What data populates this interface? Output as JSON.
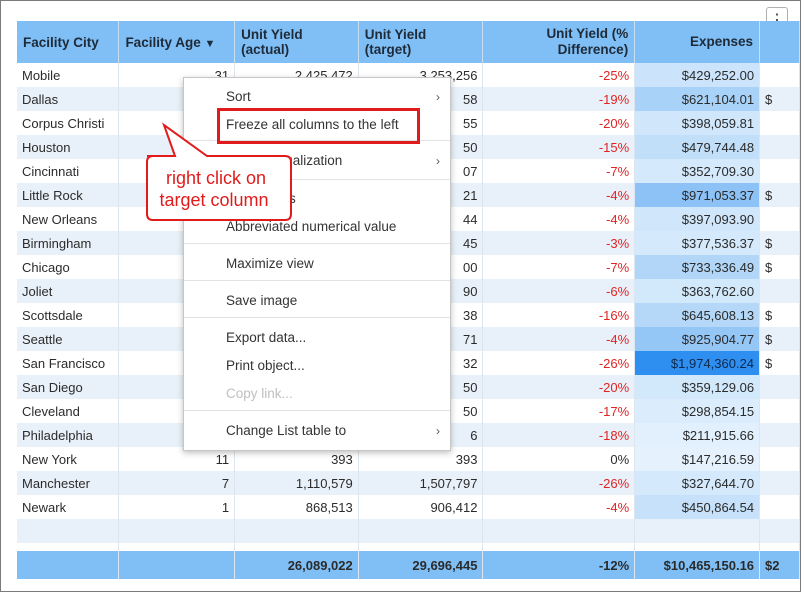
{
  "headers": [
    "Facility City",
    "Facility Age",
    "Unit Yield (actual)",
    "Unit Yield (target)",
    "Unit Yield (% Difference)",
    "Expenses",
    "$"
  ],
  "sort_indicator": "▼",
  "rows": [
    {
      "city": "Mobile",
      "age": "31",
      "actual": "2,425,472",
      "target": "3,253,256",
      "diff": "-25%",
      "exp": "$429,252.00",
      "extra": ""
    },
    {
      "city": "Dallas",
      "age": "",
      "actual": "",
      "target": "58",
      "diff": "-19%",
      "exp": "$621,104.01",
      "extra": "$"
    },
    {
      "city": "Corpus Christi",
      "age": "",
      "actual": "",
      "target": "55",
      "diff": "-20%",
      "exp": "$398,059.81",
      "extra": ""
    },
    {
      "city": "Houston",
      "age": "",
      "actual": "",
      "target": "50",
      "diff": "-15%",
      "exp": "$479,744.48",
      "extra": ""
    },
    {
      "city": "Cincinnati",
      "age": "",
      "actual": "",
      "target": "07",
      "diff": "-7%",
      "exp": "$352,709.30",
      "extra": ""
    },
    {
      "city": "Little Rock",
      "age": "",
      "actual": "",
      "target": "21",
      "diff": "-4%",
      "exp": "$971,053.37",
      "extra": "$"
    },
    {
      "city": "New Orleans",
      "age": "",
      "actual": "",
      "target": "44",
      "diff": "-4%",
      "exp": "$397,093.90",
      "extra": ""
    },
    {
      "city": "Birmingham",
      "age": "",
      "actual": "",
      "target": "45",
      "diff": "-3%",
      "exp": "$377,536.37",
      "extra": "$"
    },
    {
      "city": "Chicago",
      "age": "",
      "actual": "",
      "target": "00",
      "diff": "-7%",
      "exp": "$733,336.49",
      "extra": "$"
    },
    {
      "city": "Joliet",
      "age": "",
      "actual": "",
      "target": "90",
      "diff": "-6%",
      "exp": "$363,762.60",
      "extra": ""
    },
    {
      "city": "Scottsdale",
      "age": "",
      "actual": "",
      "target": "38",
      "diff": "-16%",
      "exp": "$645,608.13",
      "extra": "$"
    },
    {
      "city": "Seattle",
      "age": "",
      "actual": "",
      "target": "71",
      "diff": "-4%",
      "exp": "$925,904.77",
      "extra": "$"
    },
    {
      "city": "San Francisco",
      "age": "",
      "actual": "",
      "target": "32",
      "diff": "-26%",
      "exp": "$1,974,360.24",
      "extra": "$"
    },
    {
      "city": "San Diego",
      "age": "",
      "actual": "",
      "target": "50",
      "diff": "-20%",
      "exp": "$359,129.06",
      "extra": ""
    },
    {
      "city": "Cleveland",
      "age": "",
      "actual": "",
      "target": "50",
      "diff": "-17%",
      "exp": "$298,854.15",
      "extra": ""
    },
    {
      "city": "Philadelphia",
      "age": "",
      "actual": "",
      "target": "6",
      "diff": "-18%",
      "exp": "$211,915.66",
      "extra": ""
    },
    {
      "city": "New York",
      "age": "11",
      "actual": "393",
      "target": "393",
      "diff": "0%",
      "exp": "$147,216.59",
      "extra": ""
    },
    {
      "city": "Manchester",
      "age": "7",
      "actual": "1,110,579",
      "target": "1,507,797",
      "diff": "-26%",
      "exp": "$327,644.70",
      "extra": ""
    },
    {
      "city": "Newark",
      "age": "1",
      "actual": "868,513",
      "target": "906,412",
      "diff": "-4%",
      "exp": "$450,864.54",
      "extra": ""
    }
  ],
  "expense_shades": [
    "#cce4fb",
    "#a9d2f8",
    "#cfe6fb",
    "#c1dff9",
    "#d4e9fb",
    "#8cc2f6",
    "#d0e7fb",
    "#d4e9fb",
    "#b1d6f8",
    "#d2e8fb",
    "#b5d8f9",
    "#94c6f6",
    "#2f8ff0",
    "#d2e8fb",
    "#dbedfc",
    "#e1f0fc",
    "#e5f2fd",
    "#d4e9fb",
    "#c6e1f9"
  ],
  "totals": {
    "city": "",
    "age": "",
    "actual": "26,089,022",
    "target": "29,696,445",
    "diff": "-12%",
    "exp": "$10,465,150.16",
    "extra": "$2"
  },
  "context_menu": [
    {
      "label": "Sort",
      "submenu": true,
      "disabled": false
    },
    {
      "label": "Freeze all columns to the left",
      "submenu": false,
      "disabled": false
    },
    {
      "label": "Add to visualization",
      "submenu": true,
      "disabled": false
    },
    {
      "label": "Show totals",
      "submenu": false,
      "disabled": false
    },
    {
      "label": "Abbreviated numerical value",
      "submenu": false,
      "disabled": false
    },
    {
      "label": "Maximize view",
      "submenu": false,
      "disabled": false
    },
    {
      "label": "Save image",
      "submenu": false,
      "disabled": false
    },
    {
      "label": "Export data...",
      "submenu": false,
      "disabled": false
    },
    {
      "label": "Print object...",
      "submenu": false,
      "disabled": false
    },
    {
      "label": "Copy link...",
      "submenu": false,
      "disabled": true
    },
    {
      "label": "Change List table to",
      "submenu": true,
      "disabled": false
    }
  ],
  "callout": {
    "line1": "right click on",
    "line2": "target column",
    "color": "#e11b1b"
  },
  "icons": {
    "kebab": "more-vertical-icon",
    "submenu": "chevron-right-icon"
  }
}
